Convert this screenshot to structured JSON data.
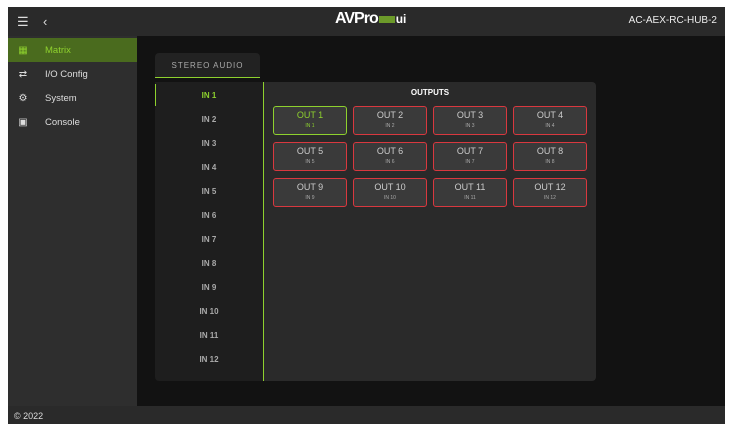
{
  "header": {
    "menu_icon": "hamburger-icon",
    "back_icon": "chevron-left-icon",
    "logo_text": "AVPro",
    "logo_suffix": "ui",
    "device_name": "AC-AEX-RC-HUB-2"
  },
  "sidebar": {
    "items": [
      {
        "label": "Matrix",
        "icon": "grid-icon",
        "active": true
      },
      {
        "label": "I/O Config",
        "icon": "arrows-icon",
        "active": false
      },
      {
        "label": "System",
        "icon": "gear-icon",
        "active": false
      },
      {
        "label": "Console",
        "icon": "terminal-icon",
        "active": false
      }
    ]
  },
  "tab": {
    "label": "STEREO AUDIO"
  },
  "inputs": [
    "IN 1",
    "IN 2",
    "IN 3",
    "IN 4",
    "IN 5",
    "IN 6",
    "IN 7",
    "IN 8",
    "IN 9",
    "IN 10",
    "IN 11",
    "IN 12"
  ],
  "selected_input": "IN 1",
  "outputs_title": "OUTPUTS",
  "outputs": [
    {
      "label": "OUT 1",
      "source": "IN 1"
    },
    {
      "label": "OUT 2",
      "source": "IN 2"
    },
    {
      "label": "OUT 3",
      "source": "IN 3"
    },
    {
      "label": "OUT 4",
      "source": "IN 4"
    },
    {
      "label": "OUT 5",
      "source": "IN 5"
    },
    {
      "label": "OUT 6",
      "source": "IN 6"
    },
    {
      "label": "OUT 7",
      "source": "IN 7"
    },
    {
      "label": "OUT 8",
      "source": "IN 8"
    },
    {
      "label": "OUT 9",
      "source": "IN 9"
    },
    {
      "label": "OUT 10",
      "source": "IN 10"
    },
    {
      "label": "OUT 11",
      "source": "IN 11"
    },
    {
      "label": "OUT 12",
      "source": "IN 12"
    }
  ],
  "footer": {
    "copyright": "© 2022"
  },
  "colors": {
    "accent": "#8ed12e",
    "unrouted": "#d9383f"
  }
}
